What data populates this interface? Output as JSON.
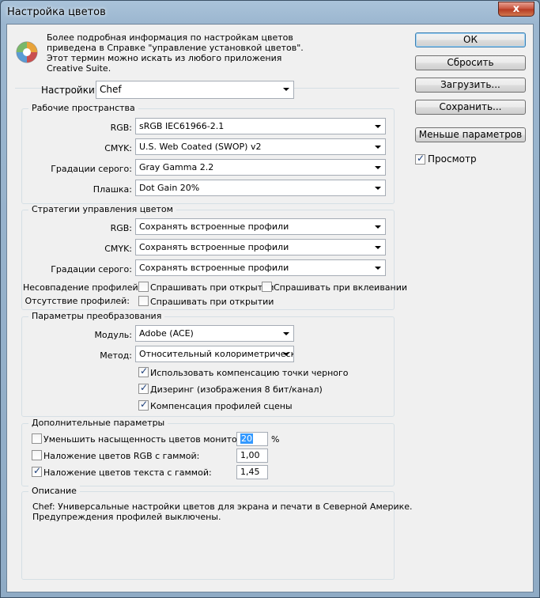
{
  "window": {
    "title": "Настройка цветов",
    "close_glyph": "x"
  },
  "info": {
    "text": "Более подробная информация по настройкам цветов приведена в Справке \"управление установкой цветов\". Этот термин можно искать из любого приложения Creative Suite."
  },
  "buttons": {
    "ok": "ОК",
    "reset": "Сбросить",
    "load": "Загрузить...",
    "save": "Сохранить...",
    "fewer": "Меньше параметров"
  },
  "preview": {
    "label": "Просмотр",
    "checked": true
  },
  "settings": {
    "label": "Настройки:",
    "value": "Chef"
  },
  "working_spaces": {
    "legend": "Рабочие пространства",
    "rgb_label": "RGB:",
    "rgb_value": "sRGB IEC61966-2.1",
    "cmyk_label": "CMYK:",
    "cmyk_value": "U.S. Web Coated (SWOP) v2",
    "gray_label": "Градации серого:",
    "gray_value": "Gray Gamma 2.2",
    "spot_label": "Плашка:",
    "spot_value": "Dot Gain 20%"
  },
  "policies": {
    "legend": "Стратегии управления цветом",
    "rgb_label": "RGB:",
    "rgb_value": "Сохранять встроенные профили",
    "cmyk_label": "CMYK:",
    "cmyk_value": "Сохранять встроенные профили",
    "gray_label": "Градации серого:",
    "gray_value": "Сохранять встроенные профили",
    "mismatch_label": "Несовпадение профилей:",
    "mismatch_open": "Спрашивать при открытии",
    "mismatch_paste": "Спрашивать при вклеивании",
    "missing_label": "Отсутствие профилей:",
    "missing_open": "Спрашивать при открытии"
  },
  "conversion": {
    "legend": "Параметры преобразования",
    "engine_label": "Модуль:",
    "engine_value": "Adobe (ACE)",
    "intent_label": "Метод:",
    "intent_value": "Относительный колориметрический",
    "bpc": "Использовать компенсацию точки черного",
    "dither": "Дизеринг (изображения 8 бит/канал)",
    "scene": "Компенсация профилей сцены"
  },
  "advanced": {
    "legend": "Дополнительные параметры",
    "desaturate": "Уменьшить насыщенность цветов монитора на:",
    "desaturate_value": "20",
    "desaturate_unit": "%",
    "blend_rgb": "Наложение цветов RGB с гаммой:",
    "blend_rgb_value": "1,00",
    "blend_text": "Наложение цветов текста с гаммой:",
    "blend_text_value": "1,45"
  },
  "description": {
    "legend": "Описание",
    "line1": "Chef:  Универсальные настройки цветов для экрана и печати в Северной Америке.",
    "line2": "Предупреждения профилей выключены."
  }
}
